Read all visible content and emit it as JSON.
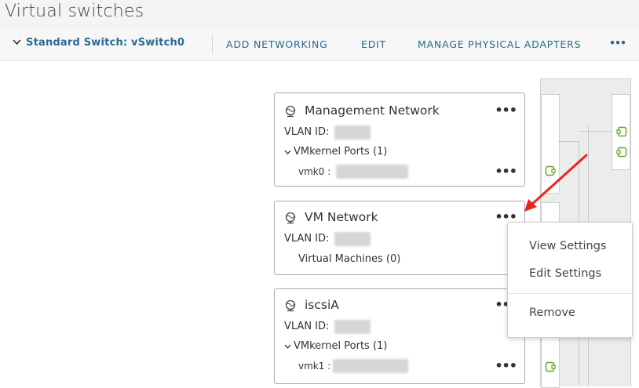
{
  "page": {
    "title": "Virtual switches"
  },
  "toolbar": {
    "switch_label": "Standard Switch: vSwitch0",
    "chevron_glyph": "❯",
    "add_networking": "ADD NETWORKING",
    "edit": "EDIT",
    "manage_adapters": "MANAGE PHYSICAL ADAPTERS",
    "more": "•••"
  },
  "port_groups": [
    {
      "name": "Management Network",
      "vlan_label": "VLAN ID:",
      "section_label": "VMkernel Ports (1)",
      "port_label": "vmk0 :",
      "more": "•••",
      "port_more": "•••",
      "icon": "network-globe-icon"
    },
    {
      "name": "VM Network",
      "vlan_label": "VLAN ID:",
      "section_label": "Virtual Machines (0)",
      "more": "•••",
      "icon": "network-globe-icon"
    },
    {
      "name": "iscsiA",
      "vlan_label": "VLAN ID:",
      "section_label": "VMkernel Ports (1)",
      "port_label": "vmk1 :",
      "more": "•••",
      "port_more": "•••",
      "icon": "network-globe-icon"
    }
  ],
  "context_menu": {
    "items": [
      "View Settings",
      "Edit Settings",
      "Remove"
    ]
  },
  "colors": {
    "accent": "#286a8e",
    "port_icon": "#62a420",
    "arrow": "#e8261f"
  }
}
